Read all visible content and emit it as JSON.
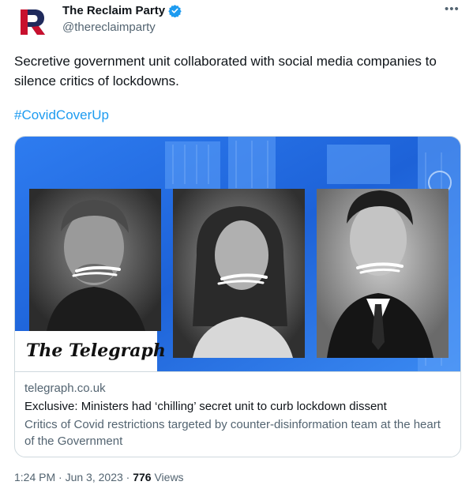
{
  "author": {
    "name": "The Reclaim Party",
    "handle": "@thereclaimparty",
    "logo_letter": "R"
  },
  "tweet": {
    "text": "Secretive government unit collaborated with social media companies to silence critics of lockdowns.",
    "hashtag": "#CovidCoverUp"
  },
  "card": {
    "brand": "The Telegraph",
    "domain": "telegraph.co.uk",
    "title": "Exclusive: Ministers had ‘chilling’ secret unit to curb lockdown dissent",
    "description": "Critics of Covid restrictions targeted by counter-disinformation team at the heart of the Government"
  },
  "meta": {
    "time": "1:24 PM",
    "date": "Jun 3, 2023",
    "views_count": "776",
    "views_label": "Views",
    "separator": "·"
  },
  "colors": {
    "accent": "#1d9bf0",
    "card_blue": "#1d6ae0",
    "logo_red": "#c8102e",
    "logo_navy": "#1f2a5c"
  },
  "icons": [
    "reclaim-logo-icon",
    "verified-badge-icon",
    "more-options-icon"
  ]
}
